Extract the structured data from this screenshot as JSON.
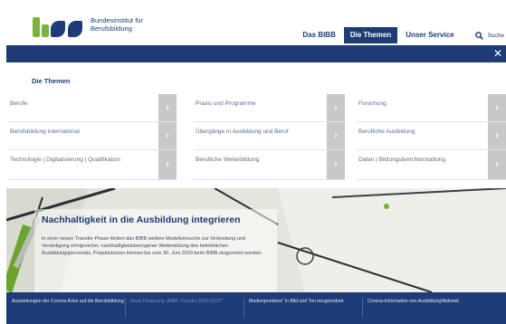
{
  "logo": {
    "name_line1": "Bundesinstitut für",
    "name_line2": "Berufsbildung"
  },
  "nav": {
    "items": [
      {
        "label": "Das BIBB",
        "active": false
      },
      {
        "label": "Die Themen",
        "active": true
      },
      {
        "label": "Unser Service",
        "active": false
      }
    ],
    "search_label": "Suche"
  },
  "menu": {
    "title": "Die Themen",
    "columns": [
      [
        {
          "label": "Berufe"
        },
        {
          "label": "Berufsbildung international"
        },
        {
          "label": "Technologie | Digitalisierung | Qualifikation"
        }
      ],
      [
        {
          "label": "Praxis und Programme"
        },
        {
          "label": "Übergänge in Ausbildung und Beruf"
        },
        {
          "label": "Berufliche Weiterbildung"
        }
      ],
      [
        {
          "label": "Forschung"
        },
        {
          "label": "Berufliche Ausbildung"
        },
        {
          "label": "Daten | Bildungsberichterstattung"
        }
      ]
    ]
  },
  "hero": {
    "title": "Nachhaltigkeit in die Ausbildung integrieren",
    "text": "In einer neuen Transfer-Phase fördert das BIBB weitere Modellversuche zur Verbreitung und Verstetigung erfolgreicher, nachhaltigkeitsbezogener Weiterbildung des betrieblichen Ausbildungspersonals. Projektskizzen können bis zum 30. Juni 2020 beim BIBB eingereicht werden."
  },
  "teasers": [
    {
      "text": "Auswirkungen der Corona-Krise auf die Berufsbildung",
      "dim": false
    },
    {
      "text": "Neue Förderung „BIBB-Transfer 2020-2022\"",
      "dim": true
    },
    {
      "text": "Medienpreisbox\" in Bild und Ton neugeordnet",
      "dim": false
    },
    {
      "text": "Corona-Information von AusbildungWeltweit",
      "dim": false
    }
  ],
  "colors": {
    "brand_blue": "#1d3c78",
    "brand_green": "#7bb33a",
    "arrow_grey": "#c8c8c8"
  },
  "icons": {
    "search": "search-icon",
    "close": "close-icon",
    "menu_arrow": "chevron-right-icon"
  }
}
